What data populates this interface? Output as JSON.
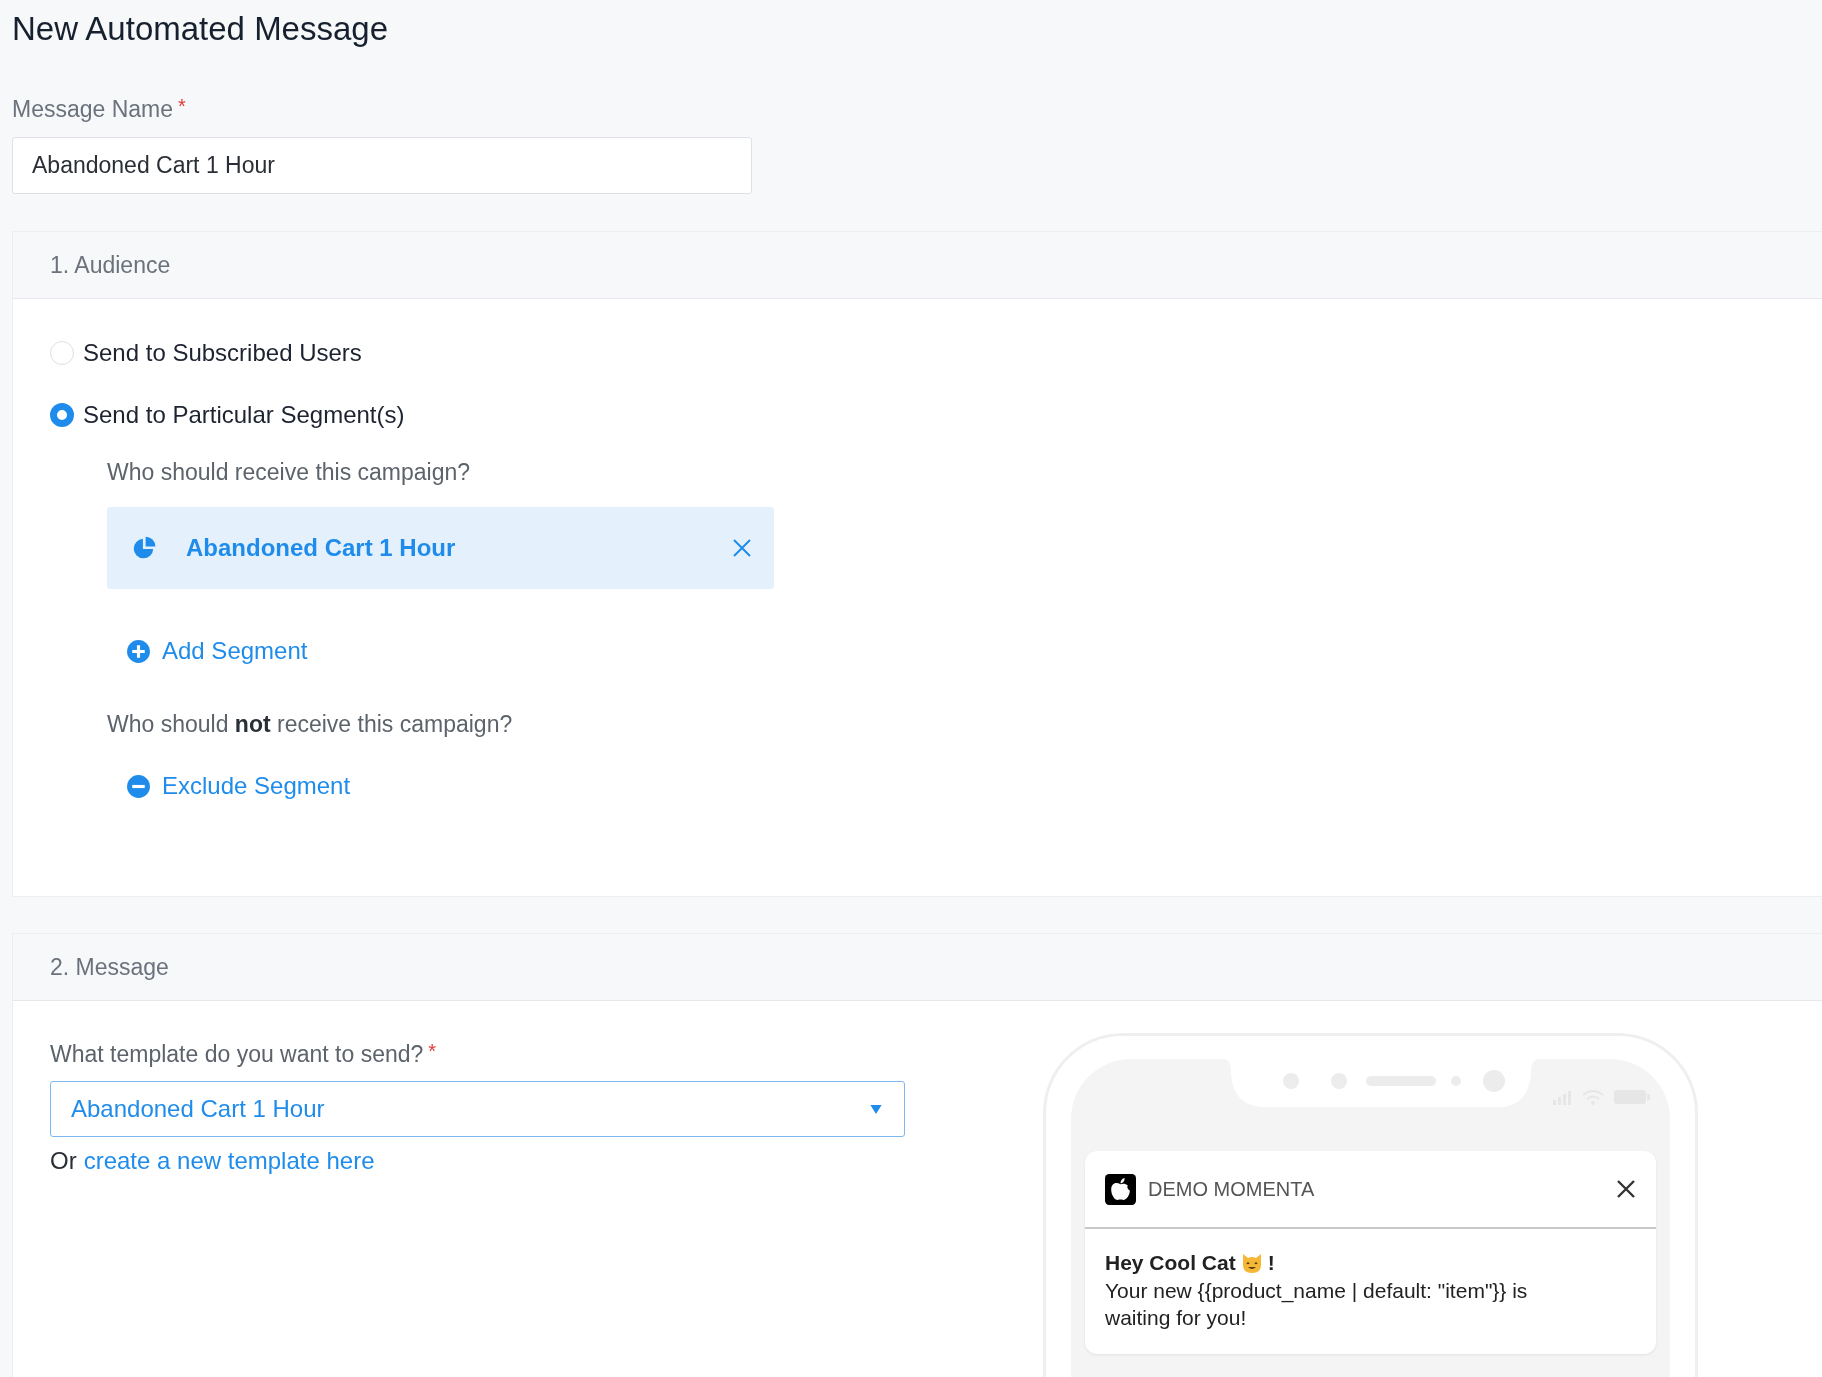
{
  "page_title": "New Automated Message",
  "message_name": {
    "label": "Message Name",
    "required_mark": "*",
    "value": "Abandoned Cart 1 Hour"
  },
  "audience": {
    "title": "1. Audience",
    "options": [
      {
        "label": "Send to Subscribed Users",
        "selected": false
      },
      {
        "label": "Send to Particular Segment(s)",
        "selected": true
      }
    ],
    "include_prompt": "Who should receive this campaign?",
    "segments": [
      {
        "name": "Abandoned Cart 1 Hour"
      }
    ],
    "add_segment": "Add Segment",
    "exclude_prompt": "Who should **not** receive this campaign?",
    "exclude_segment": "Exclude Segment"
  },
  "message": {
    "title": "2. Message",
    "template_label": "What template do you want to send?",
    "template_required_mark": "*",
    "template_value": "Abandoned Cart 1 Hour",
    "create_prefix": "Or",
    "create_link": "create a new template here",
    "preview": {
      "app_name": "DEMO MOMENTA",
      "title": "Hey Cool Cat",
      "title_end": "!",
      "body": "Your new {{product_name | default: \"item\"}} is waiting for you!"
    }
  }
}
